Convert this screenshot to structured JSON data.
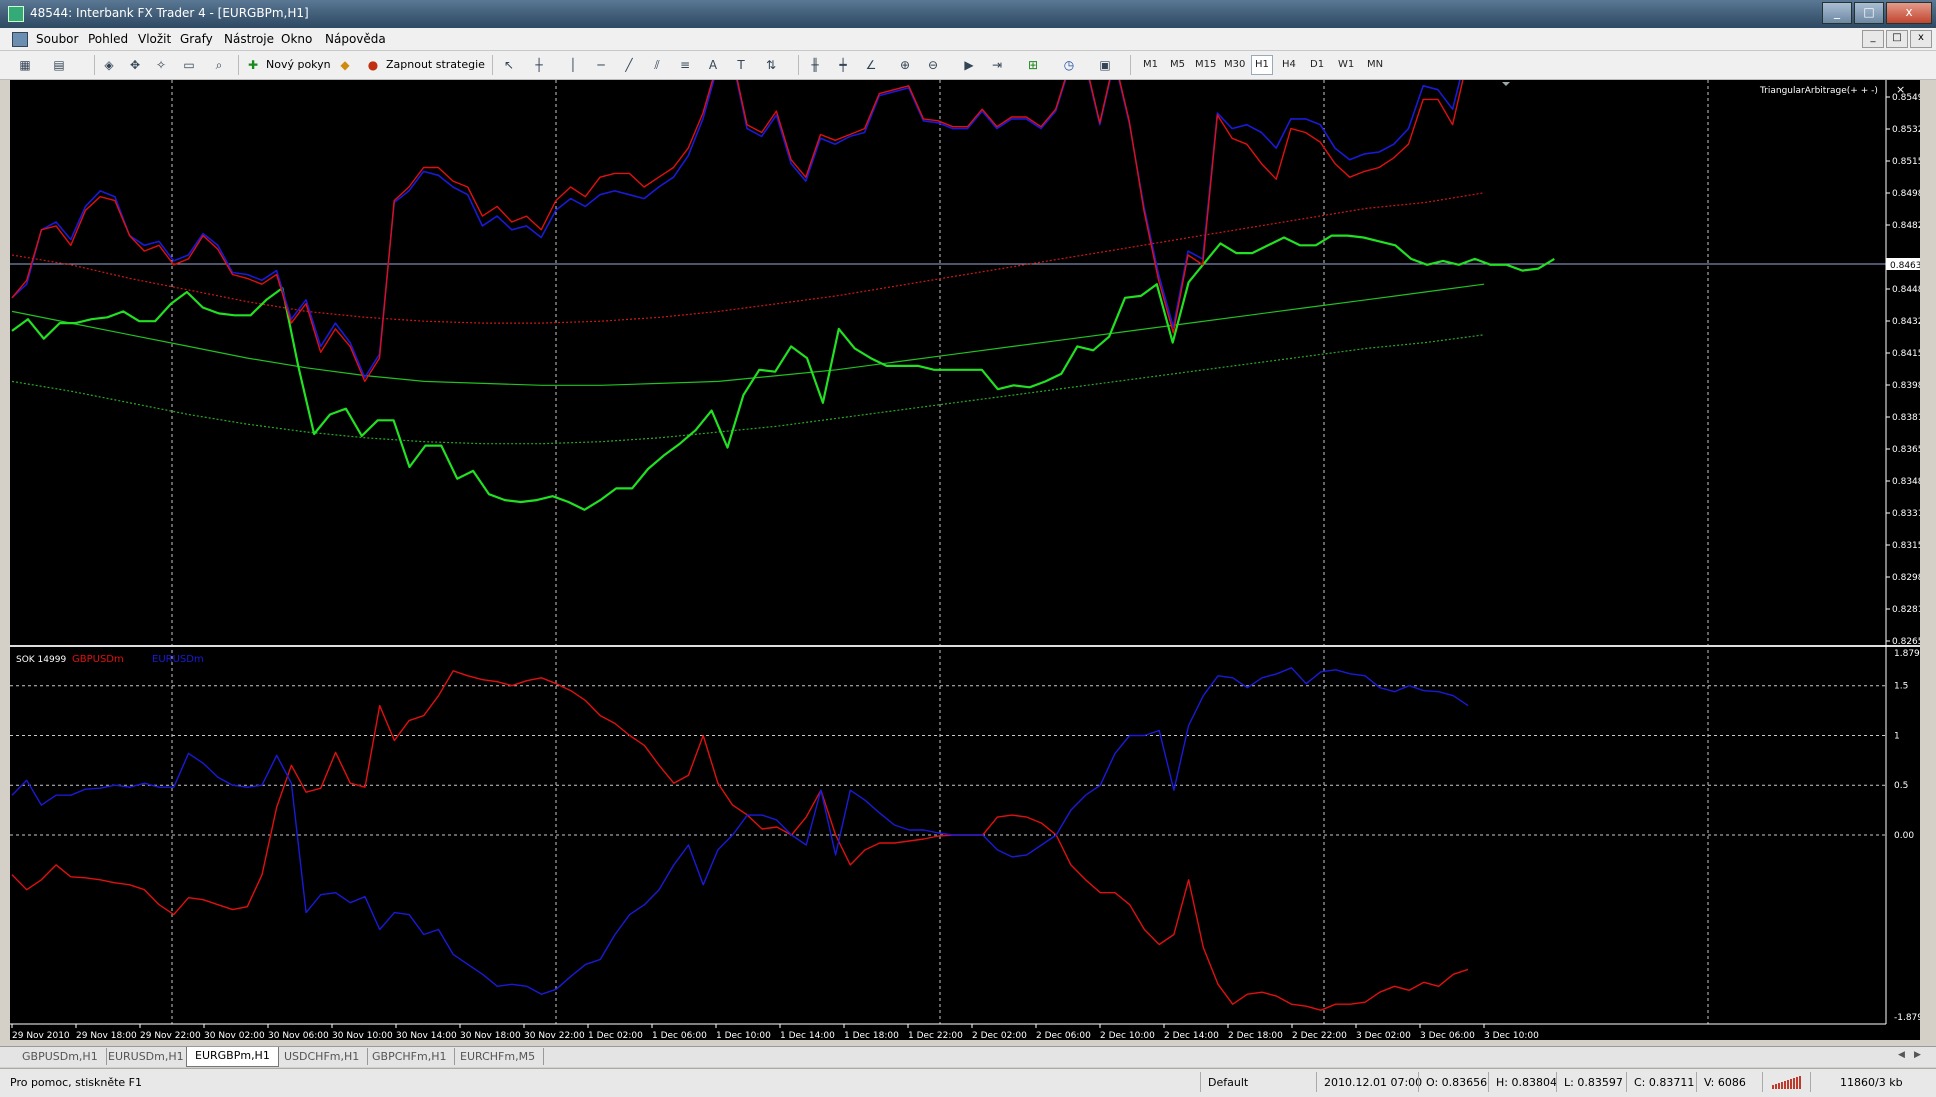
{
  "window": {
    "title": "48544: Interbank FX Trader 4 - [EURGBPm,H1]",
    "buttons": [
      "_",
      "□",
      "x"
    ]
  },
  "menu": {
    "items": [
      "Soubor",
      "Pohled",
      "Vložit",
      "Grafy",
      "Nástroje",
      "Okno",
      "Nápověda"
    ],
    "mdi_buttons": [
      "_",
      "□",
      "x"
    ]
  },
  "toolbar": {
    "new_order": "Nový pokyn",
    "strategies": "Zapnout strategie",
    "timeframes": [
      "M1",
      "M5",
      "M15",
      "M30",
      "H1",
      "H4",
      "D1",
      "W1",
      "MN"
    ],
    "active_timeframe": "H1",
    "icons": [
      "new-chart-icon",
      "profiles-icon",
      "market-watch-icon",
      "navigator-icon",
      "data-window-icon",
      "terminal-icon",
      "tester-icon",
      "new-order-icon",
      "expert-icon",
      "strategies-icon",
      "cursor-icon",
      "crosshair-icon",
      "vertical-line-icon",
      "horizontal-line-icon",
      "trendline-icon",
      "channel-icon",
      "fibonacci-icon",
      "text-icon",
      "label-icon",
      "arrows-icon",
      "bar-chart-icon",
      "candlestick-icon",
      "line-chart-icon",
      "zoom-in-icon",
      "zoom-out-icon",
      "auto-scroll-icon",
      "chart-shift-icon",
      "indicators-icon",
      "periods-icon",
      "templates-icon"
    ]
  },
  "chart_data": [
    {
      "type": "line",
      "symbol": "EURGBPm,H1",
      "indicator_label": "TriangularArbitrage(+ + -)",
      "close_icon": "×",
      "current_price": "0.84632",
      "ylim": [
        0.8265,
        0.8555
      ],
      "price_ticks": [
        "0.85490",
        "0.85320",
        "0.85155",
        "0.84985",
        "0.84820",
        "0.84632",
        "0.84485",
        "0.84320",
        "0.84150",
        "0.83985",
        "0.83815",
        "0.83650",
        "0.83485",
        "0.83315",
        "0.83150",
        "0.82980",
        "0.82815",
        "0.82650"
      ],
      "colors": {
        "price": "#e01010",
        "blue": "#1a1ad8",
        "green": "#22e022",
        "band": "#c01010",
        "band_green": "#3aa83a",
        "grid": "#c8c8c8",
        "hline": "#a8b8e8"
      },
      "series": [
        {
          "color": "#e01010",
          "values": [
            0.8443,
            0.8452,
            0.8478,
            0.848,
            0.847,
            0.8488,
            0.8495,
            0.8493,
            0.8475,
            0.8467,
            0.847,
            0.846,
            0.8463,
            0.8475,
            0.8468,
            0.8455,
            0.8453,
            0.845,
            0.8455,
            0.843,
            0.844,
            0.8415,
            0.8427,
            0.8418,
            0.84,
            0.8412,
            0.8493,
            0.85,
            0.851,
            0.851,
            0.8503,
            0.85,
            0.8485,
            0.849,
            0.8482,
            0.8485,
            0.8478,
            0.8493,
            0.85,
            0.8495,
            0.8505,
            0.8507,
            0.8507,
            0.85,
            0.8505,
            0.851,
            0.852,
            0.8538,
            0.8564,
            0.8567,
            0.8532,
            0.8528,
            0.8539,
            0.8514,
            0.8505,
            0.8527,
            0.8524,
            0.8527,
            0.853,
            0.8548,
            0.855,
            0.8552,
            0.8535,
            0.8534,
            0.8531,
            0.8531,
            0.854,
            0.8531,
            0.8536,
            0.8536,
            0.8531,
            0.854,
            0.8564,
            0.8565,
            0.8533,
            0.8566,
            0.8534,
            0.8488,
            0.8452,
            0.8425,
            0.8465,
            0.846,
            0.8537,
            0.8525,
            0.8522,
            0.8512,
            0.8504,
            0.853,
            0.8528,
            0.8523,
            0.8512,
            0.8505,
            0.8508,
            0.851,
            0.8515,
            0.8522,
            0.8545,
            0.8545,
            0.8532,
            0.8565,
            0.8585
          ]
        },
        {
          "color": "#1a1ad8",
          "values": [
            0.8443,
            0.845,
            0.8478,
            0.8482,
            0.8473,
            0.849,
            0.8498,
            0.8495,
            0.8475,
            0.847,
            0.8472,
            0.8462,
            0.8465,
            0.8476,
            0.847,
            0.8456,
            0.8455,
            0.8452,
            0.8457,
            0.8432,
            0.8442,
            0.8418,
            0.843,
            0.842,
            0.8402,
            0.8414,
            0.8492,
            0.8498,
            0.8508,
            0.8506,
            0.85,
            0.8496,
            0.848,
            0.8485,
            0.8478,
            0.848,
            0.8474,
            0.8488,
            0.8494,
            0.849,
            0.8496,
            0.8498,
            0.8496,
            0.8494,
            0.85,
            0.8505,
            0.8516,
            0.8535,
            0.8562,
            0.8566,
            0.853,
            0.8526,
            0.8537,
            0.8512,
            0.8503,
            0.8525,
            0.8522,
            0.8526,
            0.8528,
            0.8547,
            0.8549,
            0.8551,
            0.8534,
            0.8533,
            0.853,
            0.853,
            0.8539,
            0.853,
            0.8535,
            0.8535,
            0.853,
            0.8539,
            0.8563,
            0.8564,
            0.8532,
            0.8565,
            0.8533,
            0.849,
            0.8455,
            0.8428,
            0.8467,
            0.8463,
            0.8538,
            0.853,
            0.8532,
            0.8528,
            0.852,
            0.8535,
            0.8535,
            0.8532,
            0.852,
            0.8514,
            0.8517,
            0.8518,
            0.8522,
            0.853,
            0.8552,
            0.855,
            0.854,
            0.857,
            0.859
          ]
        },
        {
          "color": "#22e022",
          "values": [
            0.8426,
            0.8432,
            0.8422,
            0.843,
            0.843,
            0.8432,
            0.8433,
            0.8436,
            0.8431,
            0.8431,
            0.844,
            0.8446,
            0.8438,
            0.8435,
            0.8434,
            0.8434,
            0.8442,
            0.8448,
            0.8408,
            0.8373,
            0.8383,
            0.8386,
            0.8372,
            0.838,
            0.838,
            0.8356,
            0.8367,
            0.8367,
            0.835,
            0.8354,
            0.8342,
            0.8339,
            0.8338,
            0.8339,
            0.8341,
            0.8338,
            0.8334,
            0.8339,
            0.8345,
            0.8345,
            0.8355,
            0.8362,
            0.8368,
            0.8375,
            0.8385,
            0.8366,
            0.8393,
            0.8406,
            0.8405,
            0.8418,
            0.8412,
            0.8389,
            0.8427,
            0.8417,
            0.8412,
            0.8408,
            0.8408,
            0.8408,
            0.8406,
            0.8406,
            0.8406,
            0.8406,
            0.8396,
            0.8398,
            0.8397,
            0.84,
            0.8404,
            0.8418,
            0.8416,
            0.8423,
            0.8443,
            0.8444,
            0.845,
            0.842,
            0.8451,
            0.8461,
            0.8471,
            0.8466,
            0.8466,
            0.847,
            0.8474,
            0.847,
            0.847,
            0.8475,
            0.8475,
            0.8474,
            0.8472,
            0.847,
            0.8463,
            0.846,
            0.8462,
            0.846,
            0.8463,
            0.846,
            0.846,
            0.8457,
            0.8458,
            0.8463
          ]
        },
        {
          "color": "#22c022",
          "values": [
            0.8436,
            0.843,
            0.8424,
            0.8418,
            0.8412,
            0.8407,
            0.8403,
            0.84,
            0.8399,
            0.8398,
            0.8398,
            0.8399,
            0.84,
            0.8403,
            0.8406,
            0.841,
            0.8414,
            0.8418,
            0.8422,
            0.8426,
            0.843,
            0.8434,
            0.8438,
            0.8442,
            0.8446,
            0.845
          ]
        },
        {
          "color": "#d01818",
          "values": [
            0.8465,
            0.846,
            0.8453,
            0.8447,
            0.8441,
            0.8436,
            0.8433,
            0.8431,
            0.843,
            0.843,
            0.8431,
            0.8433,
            0.8436,
            0.844,
            0.8444,
            0.8449,
            0.8454,
            0.8459,
            0.8464,
            0.8469,
            0.8474,
            0.8479,
            0.8484,
            0.8489,
            0.8492,
            0.8497
          ]
        },
        {
          "color": "#2aa82a",
          "values": [
            0.84,
            0.8395,
            0.8389,
            0.8383,
            0.8378,
            0.8374,
            0.8371,
            0.8369,
            0.8368,
            0.8368,
            0.8369,
            0.8371,
            0.8374,
            0.8377,
            0.8381,
            0.8385,
            0.8389,
            0.8393,
            0.8397,
            0.8401,
            0.8405,
            0.8409,
            0.8413,
            0.8417,
            0.842,
            0.8424
          ]
        }
      ]
    },
    {
      "type": "line",
      "indicator_label": "SOK 14999",
      "legend": [
        "GBPUSDm",
        "EURUSDm"
      ],
      "ylim": [
        -1.879,
        1.879
      ],
      "ticks": [
        "1.879",
        "1.5",
        "1",
        "0.5",
        "0.00",
        "-1.879"
      ],
      "levels": [
        1.5,
        1,
        0.5,
        0
      ],
      "series": [
        {
          "name": "GBPUSDm",
          "color": "#e01010",
          "values": [
            -0.4,
            -0.55,
            -0.45,
            -0.3,
            -0.42,
            -0.43,
            -0.45,
            -0.48,
            -0.5,
            -0.55,
            -0.7,
            -0.8,
            -0.63,
            -0.65,
            -0.7,
            -0.75,
            -0.72,
            -0.4,
            0.28,
            0.7,
            0.43,
            0.47,
            0.83,
            0.52,
            0.48,
            1.3,
            0.95,
            1.15,
            1.2,
            1.4,
            1.65,
            1.6,
            1.56,
            1.54,
            1.5,
            1.55,
            1.58,
            1.52,
            1.45,
            1.35,
            1.2,
            1.12,
            1.0,
            0.9,
            0.7,
            0.52,
            0.6,
            1.0,
            0.52,
            0.3,
            0.2,
            0.06,
            0.08,
            0.0,
            0.18,
            0.45,
            0.0,
            -0.3,
            -0.15,
            -0.08,
            -0.08,
            -0.06,
            -0.04,
            -0.01,
            0.0,
            0.0,
            0.0,
            0.18,
            0.2,
            0.18,
            0.12,
            0.0,
            -0.3,
            -0.45,
            -0.58,
            -0.58,
            -0.7,
            -0.95,
            -1.1,
            -1.0,
            -0.45,
            -1.13,
            -1.5,
            -1.7,
            -1.6,
            -1.58,
            -1.62,
            -1.7,
            -1.72,
            -1.76,
            -1.7,
            -1.7,
            -1.68,
            -1.58,
            -1.52,
            -1.56,
            -1.48,
            -1.52,
            -1.4,
            -1.35
          ]
        },
        {
          "name": "EURUSDm",
          "color": "#1a1ad8",
          "values": [
            0.4,
            0.55,
            0.3,
            0.4,
            0.4,
            0.46,
            0.47,
            0.5,
            0.48,
            0.52,
            0.48,
            0.48,
            0.82,
            0.72,
            0.58,
            0.5,
            0.48,
            0.5,
            0.8,
            0.52,
            -0.78,
            -0.6,
            -0.58,
            -0.68,
            -0.62,
            -0.95,
            -0.78,
            -0.8,
            -1.0,
            -0.95,
            -1.2,
            -1.3,
            -1.4,
            -1.52,
            -1.5,
            -1.52,
            -1.6,
            -1.55,
            -1.42,
            -1.3,
            -1.25,
            -1.0,
            -0.8,
            -0.7,
            -0.55,
            -0.3,
            -0.1,
            -0.5,
            -0.15,
            0.0,
            0.2,
            0.2,
            0.15,
            0.0,
            -0.1,
            0.45,
            -0.2,
            0.45,
            0.35,
            0.22,
            0.1,
            0.05,
            0.05,
            0.02,
            0.0,
            0.0,
            0.0,
            -0.15,
            -0.22,
            -0.2,
            -0.1,
            0.0,
            0.25,
            0.4,
            0.5,
            0.82,
            1.0,
            1.0,
            1.05,
            0.45,
            1.1,
            1.4,
            1.6,
            1.58,
            1.48,
            1.58,
            1.62,
            1.68,
            1.52,
            1.64,
            1.66,
            1.62,
            1.6,
            1.48,
            1.44,
            1.5,
            1.45,
            1.44,
            1.4,
            1.3
          ]
        }
      ]
    }
  ],
  "time_axis": [
    "29 Nov 2010",
    "29 Nov 18:00",
    "29 Nov 22:00",
    "30 Nov 02:00",
    "30 Nov 06:00",
    "30 Nov 10:00",
    "30 Nov 14:00",
    "30 Nov 18:00",
    "30 Nov 22:00",
    "1 Dec 02:00",
    "1 Dec 06:00",
    "1 Dec 10:00",
    "1 Dec 14:00",
    "1 Dec 18:00",
    "1 Dec 22:00",
    "2 Dec 02:00",
    "2 Dec 06:00",
    "2 Dec 10:00",
    "2 Dec 14:00",
    "2 Dec 18:00",
    "2 Dec 22:00",
    "3 Dec 02:00",
    "3 Dec 06:00",
    "3 Dec 10:00"
  ],
  "tabs": [
    "GBPUSDm,H1",
    "EURUSDm,H1",
    "EURGBPm,H1",
    "USDCHFm,H1",
    "GBPCHFm,H1",
    "EURCHFm,M5"
  ],
  "active_tab": "EURGBPm,H1",
  "status": {
    "help": "Pro pomoc, stiskněte F1",
    "profile": "Default",
    "datetime": "2010.12.01 07:00",
    "open": "O: 0.83656",
    "high": "H: 0.83804",
    "low": "L: 0.83597",
    "close": "C: 0.83711",
    "volume": "V: 6086",
    "traffic": "11860/3 kb"
  }
}
